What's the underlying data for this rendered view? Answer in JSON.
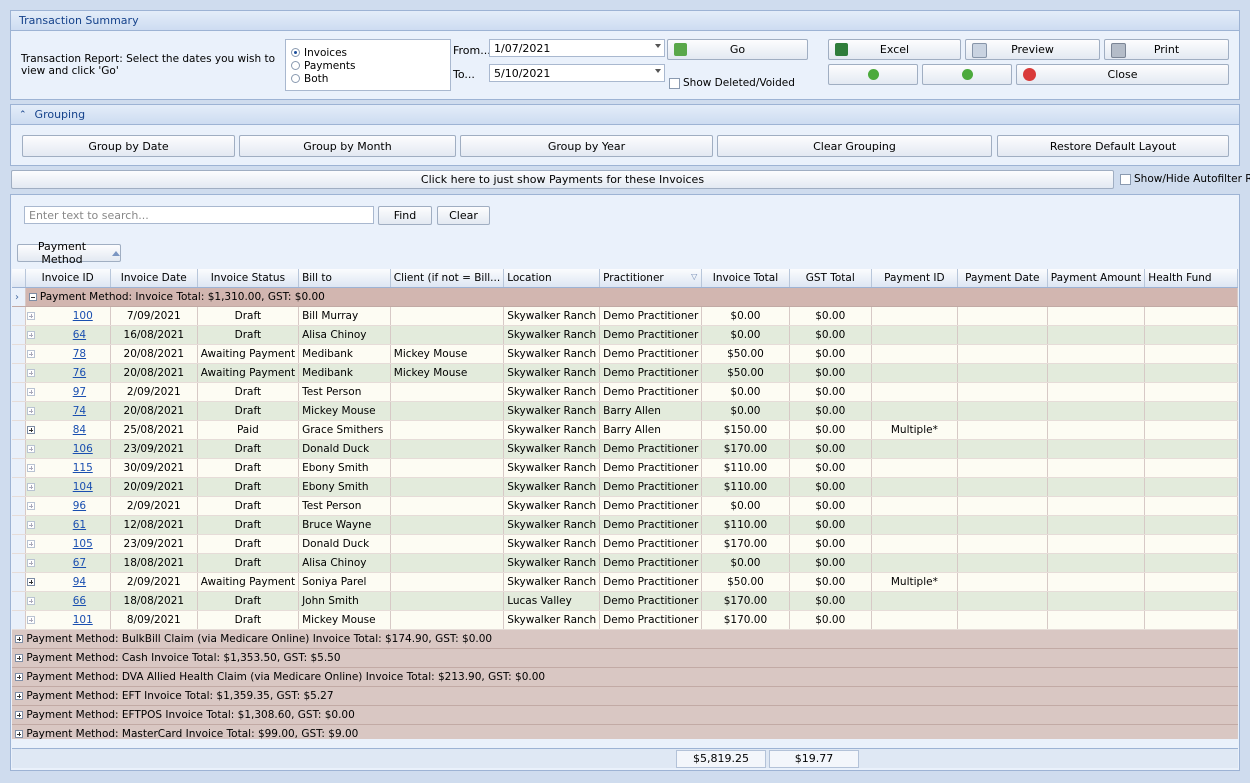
{
  "summary": {
    "title": "Transaction Summary",
    "description": "Transaction Report: Select the dates you wish to view and click 'Go'",
    "radios": [
      {
        "label": "Invoices",
        "selected": true
      },
      {
        "label": "Payments",
        "selected": false
      },
      {
        "label": "Both",
        "selected": false
      }
    ],
    "from_label": "From...",
    "from_value": "1/07/2021",
    "to_label": "To...",
    "to_value": "5/10/2021",
    "go_label": "Go",
    "show_deleted_label": "Show Deleted/Voided",
    "excel_label": "Excel",
    "preview_label": "Preview",
    "print_label": "Print",
    "close_label": "Close"
  },
  "grouping": {
    "title": "Grouping",
    "buttons": [
      "Group by Date",
      "Group by Month",
      "Group by Year",
      "Clear Grouping",
      "Restore Default Layout"
    ]
  },
  "payments_bar_label": "Click here to just show Payments for these Invoices",
  "autofilter_label": "Show/Hide Autofilter Rov",
  "search": {
    "placeholder": "Enter text to search...",
    "find_label": "Find",
    "clear_label": "Clear"
  },
  "group_chip": "Payment Method",
  "columns": [
    "Invoice ID",
    "Invoice Date",
    "Invoice Status",
    "Bill to",
    "Client (if not = Bill...",
    "Location",
    "Practitioner",
    "Invoice Total",
    "GST Total",
    "Payment ID",
    "Payment Date",
    "Payment Amount",
    "Health Fund"
  ],
  "first_group": "Payment Method:  Invoice Total: $1,310.00, GST: $0.00",
  "rows": [
    {
      "id": "100",
      "date": "7/09/2021",
      "status": "Draft",
      "bill": "Bill Murray",
      "client": "",
      "loc": "Skywalker Ranch",
      "prac": "Demo Practitioner",
      "total": "$0.00",
      "gst": "$0.00",
      "pid": ""
    },
    {
      "id": "64",
      "date": "16/08/2021",
      "status": "Draft",
      "bill": "Alisa Chinoy",
      "client": "",
      "loc": "Skywalker Ranch",
      "prac": "Demo Practitioner",
      "total": "$0.00",
      "gst": "$0.00",
      "pid": ""
    },
    {
      "id": "78",
      "date": "20/08/2021",
      "status": "Awaiting Payment",
      "bill": "Medibank",
      "client": "Mickey Mouse",
      "loc": "Skywalker Ranch",
      "prac": "Demo Practitioner",
      "total": "$50.00",
      "gst": "$0.00",
      "pid": ""
    },
    {
      "id": "76",
      "date": "20/08/2021",
      "status": "Awaiting Payment",
      "bill": "Medibank",
      "client": "Mickey Mouse",
      "loc": "Skywalker Ranch",
      "prac": "Demo Practitioner",
      "total": "$50.00",
      "gst": "$0.00",
      "pid": ""
    },
    {
      "id": "97",
      "date": "2/09/2021",
      "status": "Draft",
      "bill": "Test  Person",
      "client": "",
      "loc": "Skywalker Ranch",
      "prac": "Demo Practitioner",
      "total": "$0.00",
      "gst": "$0.00",
      "pid": ""
    },
    {
      "id": "74",
      "date": "20/08/2021",
      "status": "Draft",
      "bill": "Mickey Mouse",
      "client": "",
      "loc": "Skywalker Ranch",
      "prac": "Barry Allen",
      "total": "$0.00",
      "gst": "$0.00",
      "pid": ""
    },
    {
      "id": "84",
      "date": "25/08/2021",
      "status": "Paid",
      "bill": "Grace Smithers",
      "client": "",
      "loc": "Skywalker Ranch",
      "prac": "Barry Allen",
      "total": "$150.00",
      "gst": "$0.00",
      "pid": "Multiple*"
    },
    {
      "id": "106",
      "date": "23/09/2021",
      "status": "Draft",
      "bill": "Donald Duck",
      "client": "",
      "loc": "Skywalker Ranch",
      "prac": "Demo Practitioner",
      "total": "$170.00",
      "gst": "$0.00",
      "pid": ""
    },
    {
      "id": "115",
      "date": "30/09/2021",
      "status": "Draft",
      "bill": "Ebony Smith",
      "client": "",
      "loc": "Skywalker Ranch",
      "prac": "Demo Practitioner",
      "total": "$110.00",
      "gst": "$0.00",
      "pid": ""
    },
    {
      "id": "104",
      "date": "20/09/2021",
      "status": "Draft",
      "bill": "Ebony Smith",
      "client": "",
      "loc": "Skywalker Ranch",
      "prac": "Demo Practitioner",
      "total": "$110.00",
      "gst": "$0.00",
      "pid": ""
    },
    {
      "id": "96",
      "date": "2/09/2021",
      "status": "Draft",
      "bill": "Test  Person",
      "client": "",
      "loc": "Skywalker Ranch",
      "prac": "Demo Practitioner",
      "total": "$0.00",
      "gst": "$0.00",
      "pid": ""
    },
    {
      "id": "61",
      "date": "12/08/2021",
      "status": "Draft",
      "bill": "Bruce Wayne",
      "client": "",
      "loc": "Skywalker Ranch",
      "prac": "Demo Practitioner",
      "total": "$110.00",
      "gst": "$0.00",
      "pid": ""
    },
    {
      "id": "105",
      "date": "23/09/2021",
      "status": "Draft",
      "bill": "Donald Duck",
      "client": "",
      "loc": "Skywalker Ranch",
      "prac": "Demo Practitioner",
      "total": "$170.00",
      "gst": "$0.00",
      "pid": ""
    },
    {
      "id": "67",
      "date": "18/08/2021",
      "status": "Draft",
      "bill": "Alisa Chinoy",
      "client": "",
      "loc": "Skywalker Ranch",
      "prac": "Demo Practitioner",
      "total": "$0.00",
      "gst": "$0.00",
      "pid": ""
    },
    {
      "id": "94",
      "date": "2/09/2021",
      "status": "Awaiting Payment",
      "bill": "Soniya Parel",
      "client": "",
      "loc": "Skywalker Ranch",
      "prac": "Demo Practitioner",
      "total": "$50.00",
      "gst": "$0.00",
      "pid": "Multiple*"
    },
    {
      "id": "66",
      "date": "18/08/2021",
      "status": "Draft",
      "bill": "John Smith",
      "client": "",
      "loc": "Lucas Valley",
      "prac": "Demo Practitioner",
      "total": "$170.00",
      "gst": "$0.00",
      "pid": ""
    },
    {
      "id": "101",
      "date": "8/09/2021",
      "status": "Draft",
      "bill": "Mickey Mouse",
      "client": "",
      "loc": "Skywalker Ranch",
      "prac": "Demo Practitioner",
      "total": "$170.00",
      "gst": "$0.00",
      "pid": ""
    }
  ],
  "groups": [
    "Payment Method: BulkBill Claim (via Medicare Online) Invoice Total: $174.90, GST: $0.00",
    "Payment Method: Cash Invoice Total: $1,353.50, GST: $5.50",
    "Payment Method: DVA Allied Health Claim (via Medicare Online) Invoice Total: $213.90, GST: $0.00",
    "Payment Method: EFT Invoice Total: $1,359.35, GST: $5.27",
    "Payment Method: EFTPOS Invoice Total: $1,308.60, GST: $0.00",
    "Payment Method: MasterCard Invoice Total: $99.00, GST: $9.00"
  ],
  "footer": {
    "invoice_total": "$5,819.25",
    "gst_total": "$19.77"
  },
  "colors": {
    "accent": "#15428b",
    "group_row": "#d9c7c3",
    "row_alt": "#e3ebdc"
  }
}
